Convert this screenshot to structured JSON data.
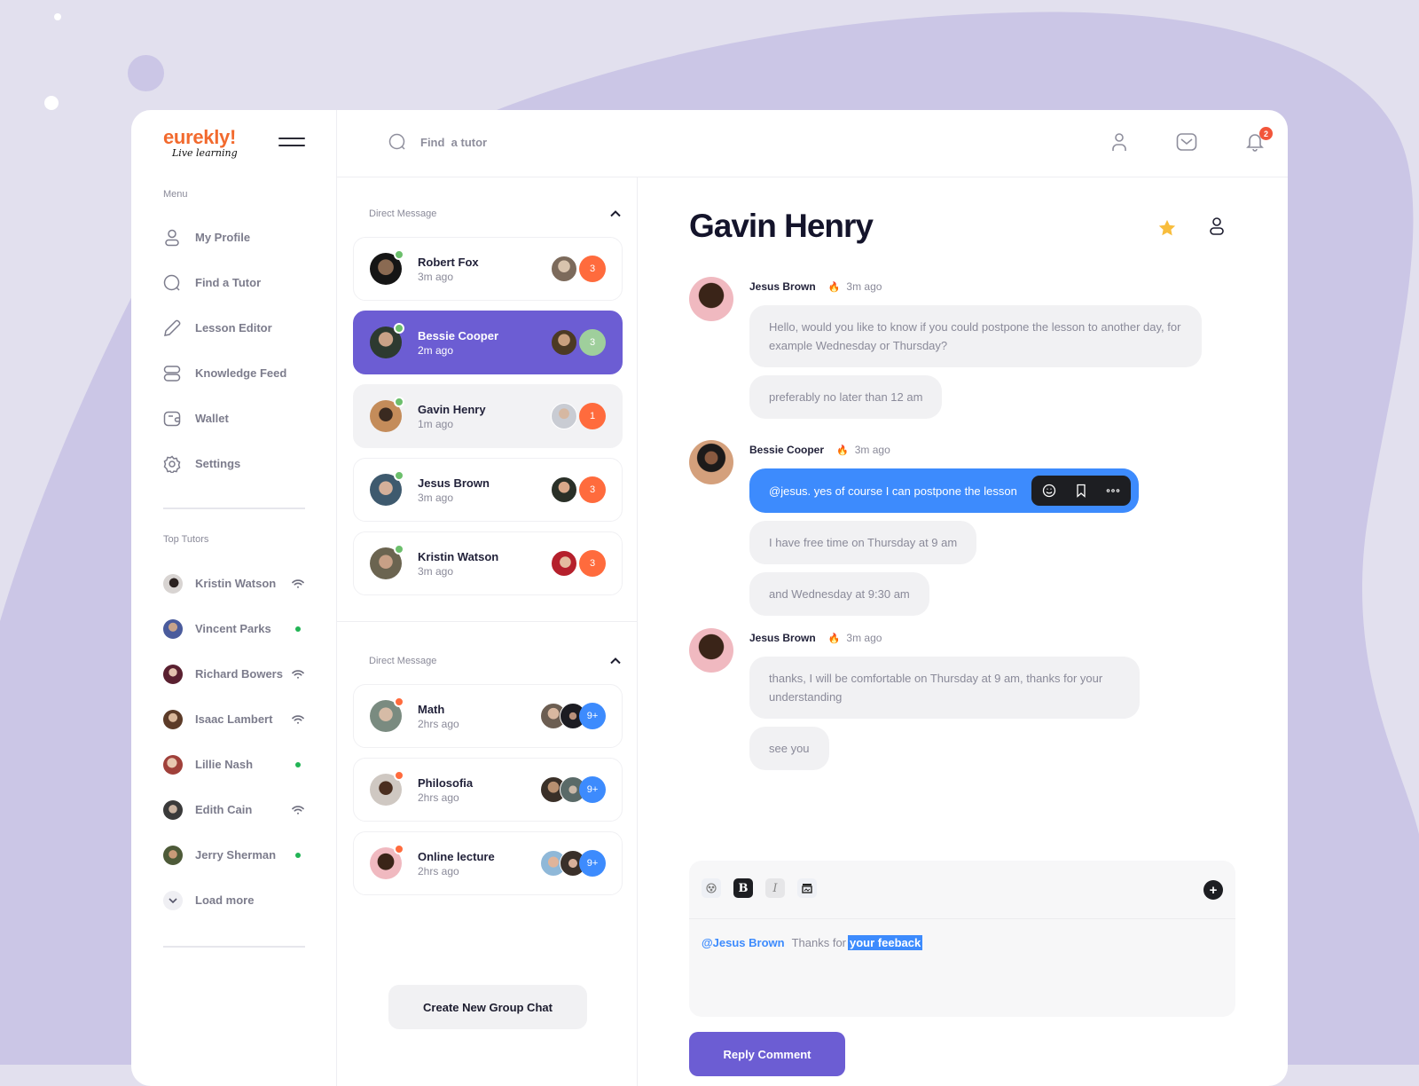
{
  "brand": {
    "name": "eurekly!",
    "tagline": "Live learning"
  },
  "sidebar": {
    "menu_title": "Menu",
    "items": [
      {
        "label": "My Profile",
        "icon": "user-icon"
      },
      {
        "label": "Find a Tutor",
        "icon": "search-icon"
      },
      {
        "label": "Lesson Editor",
        "icon": "pencil-icon"
      },
      {
        "label": "Knowledge Feed",
        "icon": "feed-icon"
      },
      {
        "label": "Wallet",
        "icon": "wallet-icon"
      },
      {
        "label": "Settings",
        "icon": "gear-icon"
      }
    ],
    "tutors_title": "Top Tutors",
    "tutors": [
      {
        "name": "Kristin Watson",
        "status": "wifi"
      },
      {
        "name": "Vincent Parks",
        "status": "online"
      },
      {
        "name": "Richard Bowers",
        "status": "wifi"
      },
      {
        "name": "Isaac Lambert",
        "status": "wifi"
      },
      {
        "name": "Lillie Nash",
        "status": "online"
      },
      {
        "name": "Edith Cain",
        "status": "wifi"
      },
      {
        "name": "Jerry Sherman",
        "status": "online"
      }
    ],
    "load_more": "Load more"
  },
  "topbar": {
    "search_placeholder": "Find  a tutor",
    "notifications_count": "2"
  },
  "conversations": {
    "direct_title": "Direct Message",
    "direct": [
      {
        "name": "Robert Fox",
        "time": "3m ago",
        "count": "3",
        "count_color": "#ff6b3d"
      },
      {
        "name": "Bessie Cooper",
        "time": "2m ago",
        "count": "3",
        "count_color": "#9fcf9c",
        "active": true
      },
      {
        "name": "Gavin Henry",
        "time": "1m ago",
        "count": "1",
        "count_color": "#ff6b3d"
      },
      {
        "name": "Jesus Brown",
        "time": "3m ago",
        "count": "3",
        "count_color": "#ff6b3d"
      },
      {
        "name": "Kristin Watson",
        "time": "3m ago",
        "count": "3",
        "count_color": "#ff6b3d"
      }
    ],
    "group_title": "Direct Message",
    "groups": [
      {
        "name": "Math",
        "time": "2hrs ago",
        "count": "9+"
      },
      {
        "name": "Philosofia",
        "time": "2hrs ago",
        "count": "9+"
      },
      {
        "name": "Online lecture",
        "time": "2hrs ago",
        "count": "9+"
      }
    ],
    "create_button": "Create New Group Chat"
  },
  "chat": {
    "title": "Gavin Henry",
    "messages": [
      {
        "sender": "Jesus Brown",
        "time": "3m ago",
        "bubbles": [
          "Hello, would you like to know if you could postpone the lesson to another day, for example Wednesday or Thursday?",
          "preferably no later than 12 am"
        ]
      },
      {
        "sender": "Bessie Cooper",
        "time": "3m ago",
        "bubbles": [
          "@jesus. yes of course I can postpone the lesson",
          "I have free time on Thursday at 9 am",
          "and Wednesday at 9:30 am"
        ]
      },
      {
        "sender": "Jesus Brown",
        "time": "3m ago",
        "bubbles": [
          "thanks, I will be comfortable on Thursday at 9 am, thanks for your understanding",
          "see you"
        ]
      }
    ],
    "composer": {
      "mention": "@Jesus Brown",
      "text": "Thanks for",
      "highlighted": "your feeback"
    },
    "reply_button": "Reply Comment"
  },
  "colors": {
    "accent": "#6c5dd3",
    "blue": "#3d8bfd",
    "orange": "#f26a2e",
    "online": "#22b455"
  }
}
